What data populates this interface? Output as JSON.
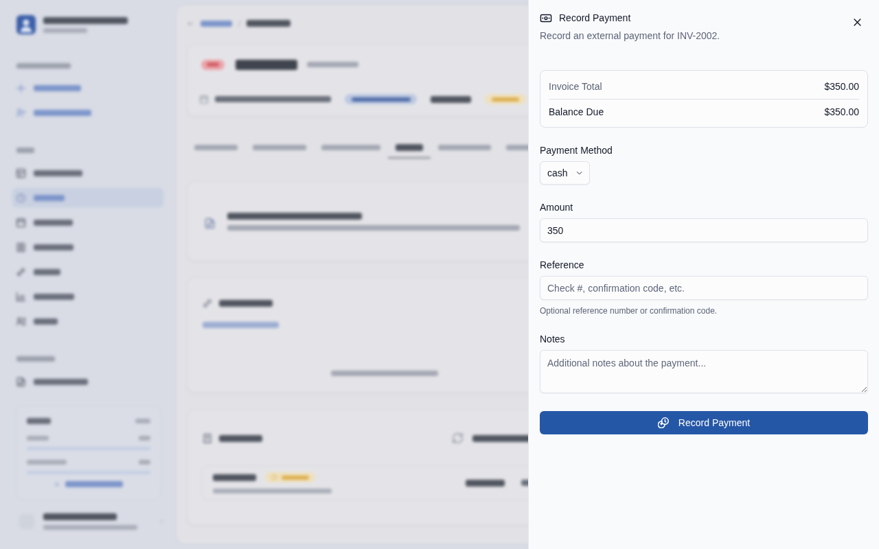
{
  "payment_panel": {
    "title": "Record Payment",
    "description": "Record an external payment for INV-2002.",
    "summary": [
      {
        "kind": "total",
        "label": "Invoice Total",
        "value": "$350.00"
      },
      {
        "kind": "due",
        "label": "Balance Due",
        "value": "$350.00"
      }
    ],
    "fields": [
      {
        "kind": "select",
        "label": "Payment Method",
        "value": "cash"
      },
      {
        "kind": "input",
        "label": "Amount",
        "value": "350"
      },
      {
        "kind": "input",
        "label": "Reference",
        "placeholder": "Check #, confirmation code, etc.",
        "help": "Optional reference number or confirmation code."
      },
      {
        "kind": "textarea",
        "label": "Notes",
        "placeholder": "Additional notes about the payment..."
      }
    ],
    "submit": "Record Payment"
  }
}
